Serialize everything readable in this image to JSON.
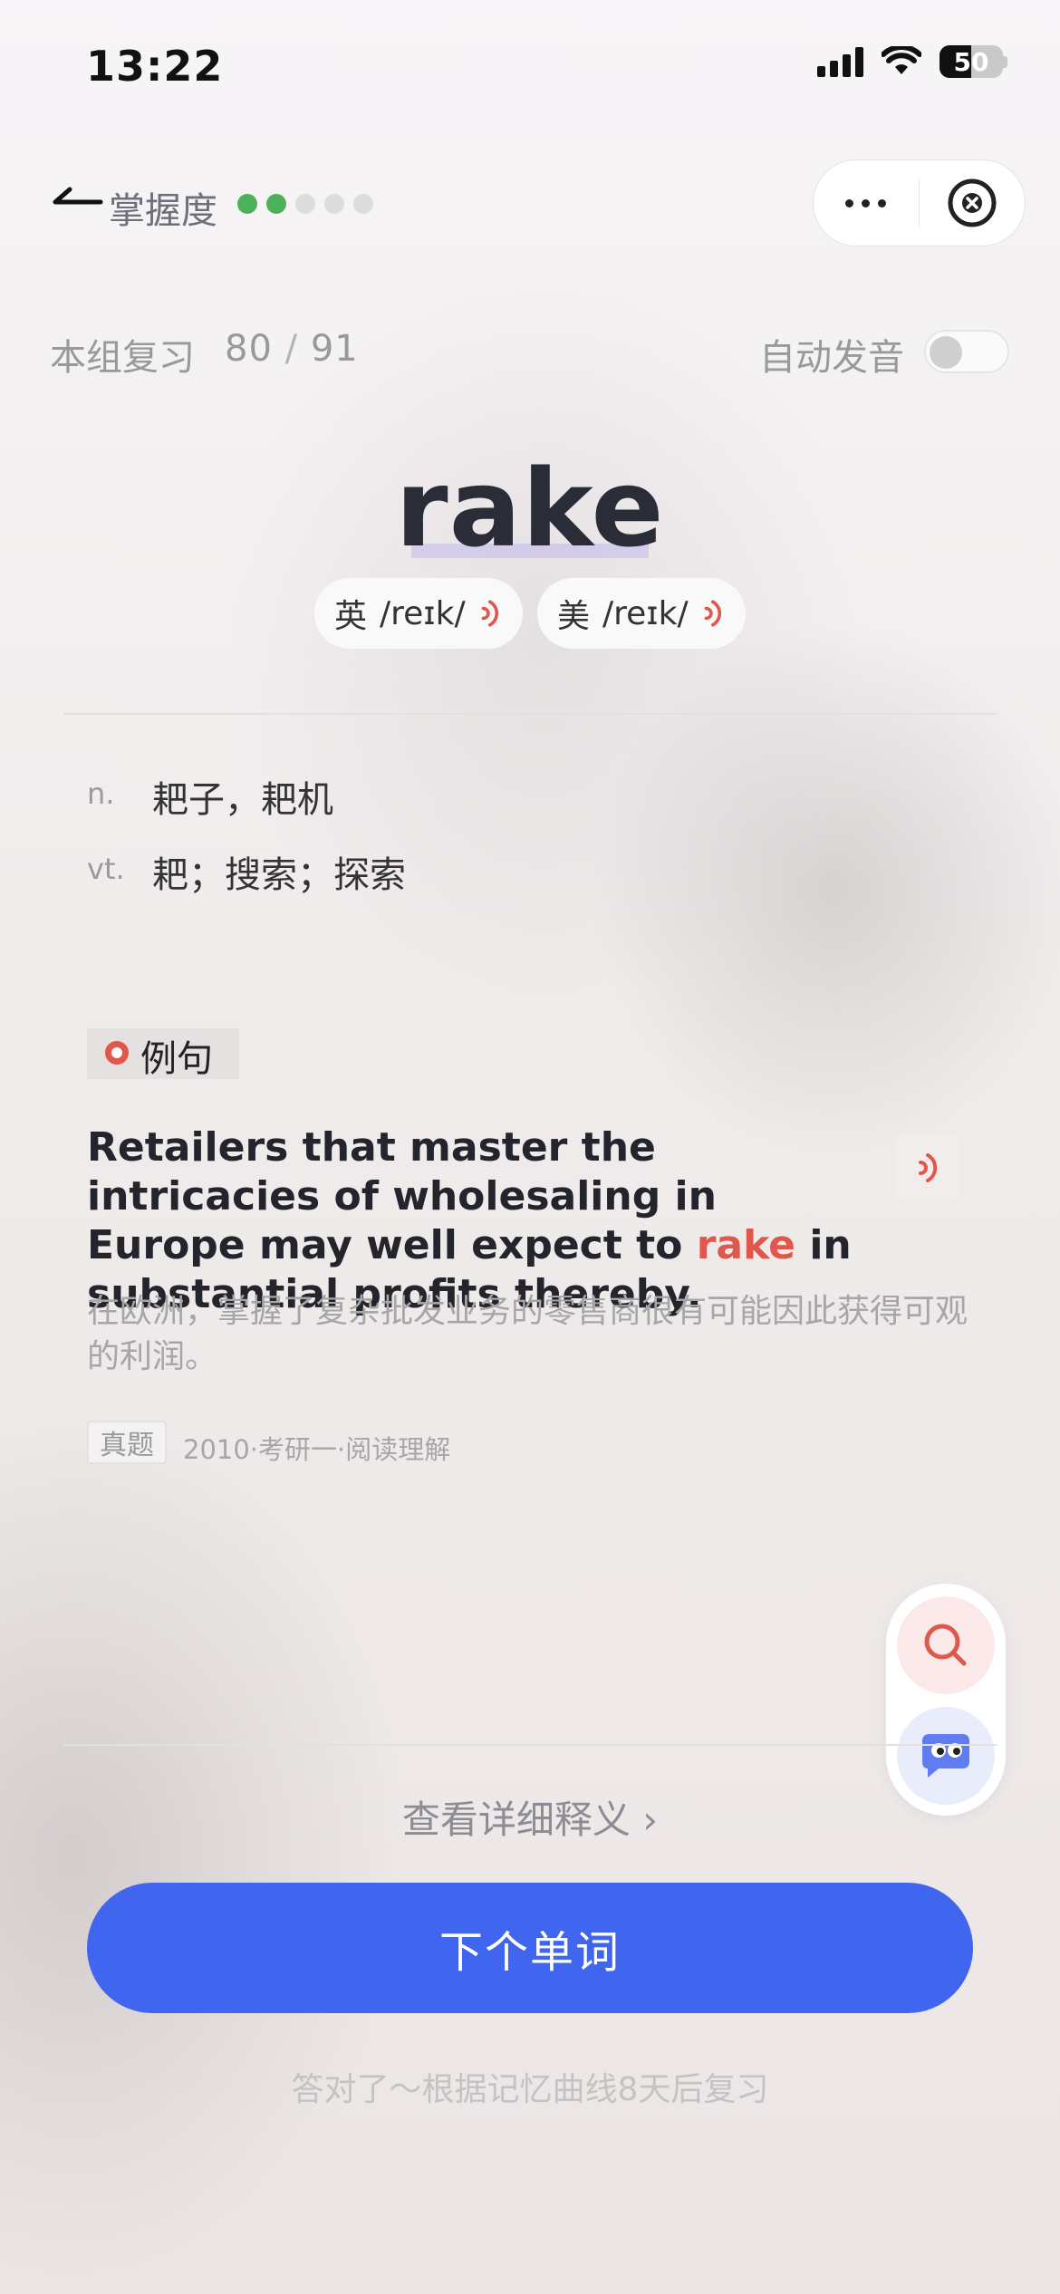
{
  "status_bar": {
    "time": "13:22",
    "battery": "50",
    "battery_level": 0.5
  },
  "nav": {
    "mastery_label": "掌握度",
    "mastery_dots": [
      true,
      true,
      false,
      false,
      false
    ]
  },
  "progress": {
    "label": "本组复习",
    "current": "80",
    "total": "91",
    "auto_pronounce_label": "自动发音",
    "auto_pronounce_on": false
  },
  "word": {
    "text": "rake",
    "phonetics": [
      {
        "region": "英",
        "ipa": "/reɪk/"
      },
      {
        "region": "美",
        "ipa": "/reɪk/"
      }
    ]
  },
  "definitions": [
    {
      "pos": "n.",
      "meaning": "耙子，耙机"
    },
    {
      "pos": "vt.",
      "meaning": "耙；搜索；探索"
    }
  ],
  "example": {
    "label": "例句",
    "sentence_before": "Retailers that master the intricacies of wholesaling in Europe may well expect to ",
    "sentence_highlight": "rake",
    "sentence_after": " in substantial profits thereby.",
    "translation": "在欧洲，掌握了复杂批发业务的零售商很有可能因此获得可观的利润。",
    "source_badge": "真题",
    "source_text": "2010·考研一·阅读理解"
  },
  "actions": {
    "detail_link": "查看详细释义",
    "next_button": "下个单词",
    "hint": "答对了～根据记忆曲线8天后复习"
  },
  "colors": {
    "accent": "#4066ef",
    "highlight": "#e0574b",
    "mastery": "#4cb15a"
  }
}
